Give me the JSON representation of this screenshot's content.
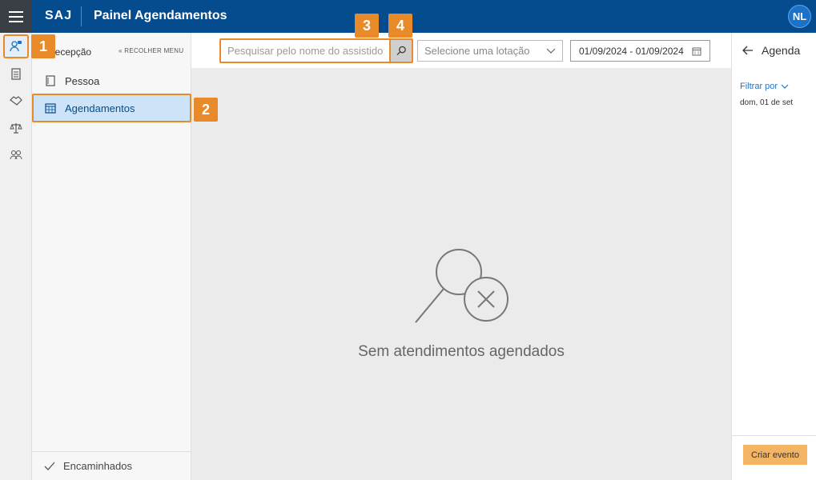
{
  "topbar": {
    "brand": "SAJ",
    "title": "Painel Agendamentos",
    "user_name": "",
    "avatar_initials": "NL"
  },
  "callouts": [
    "1",
    "2",
    "3",
    "4"
  ],
  "sidebar": {
    "header": "Recepção",
    "collapse_label": "« RECOLHER MENU",
    "items": [
      {
        "label": "Pessoa",
        "icon": "person-card-icon"
      },
      {
        "label": "Agendamentos",
        "icon": "calendar-icon"
      }
    ],
    "footer_item": {
      "label": "Encaminhados",
      "icon": "check-icon"
    }
  },
  "rail": {
    "icons": [
      "reception-icon",
      "clipboard-icon",
      "handshake-icon",
      "scales-icon",
      "people-icon"
    ]
  },
  "toolbar": {
    "search_placeholder": "Pesquisar pelo nome do assistido",
    "select_placeholder": "Selecione uma lotação",
    "date_range": "01/09/2024 - 01/09/2024"
  },
  "main": {
    "empty_message": "Sem atendimentos agendados"
  },
  "right_panel": {
    "title": "Agenda",
    "filter_label": "Filtrar por",
    "date_label": "dom, 01 de set",
    "create_button": "Criar evento"
  },
  "colors": {
    "topbar": "#054c8e",
    "accent_orange": "#e88a2a",
    "selected_bg": "#cde3f7",
    "create_button": "#f3b563"
  }
}
